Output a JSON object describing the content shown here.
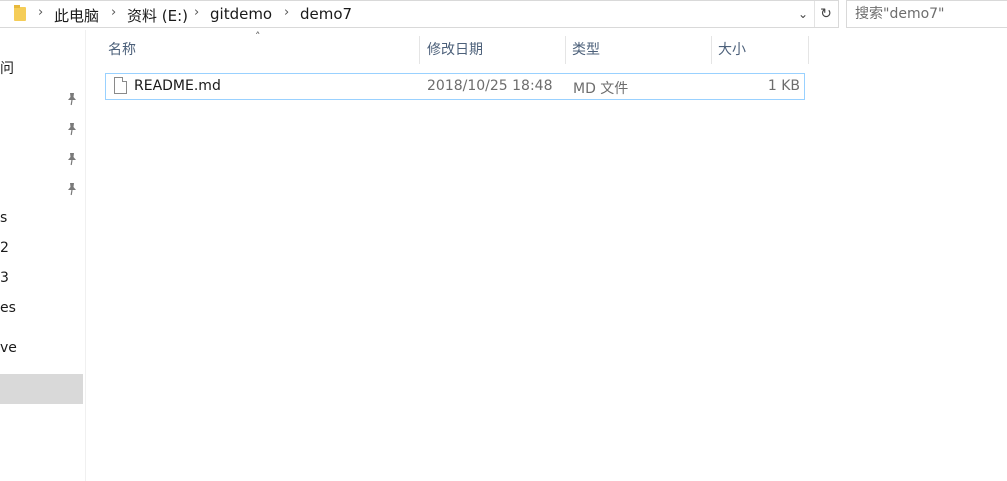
{
  "address_bar": {
    "breadcrumbs": [
      "此电脑",
      "资料 (E:)",
      "gitdemo",
      "demo7"
    ],
    "folder_icon": "folder-icon",
    "dropdown_icon": "chevron-down-icon",
    "refresh_icon": "refresh-icon"
  },
  "search": {
    "placeholder": "搜索\"demo7\""
  },
  "nav": {
    "items": [
      "问",
      "s",
      "2",
      "3",
      "es",
      "ve"
    ],
    "pins": 4
  },
  "columns": {
    "name": "名称",
    "modified": "修改日期",
    "type": "类型",
    "size": "大小"
  },
  "files": [
    {
      "name": "README.md",
      "modified": "2018/10/25 18:48",
      "type": "MD 文件",
      "size": "1 KB",
      "icon": "document-icon"
    }
  ],
  "colors": {
    "selection_border": "#99d1ff",
    "header_text": "#4c607a",
    "nav_selected": "#d9d9d9"
  }
}
